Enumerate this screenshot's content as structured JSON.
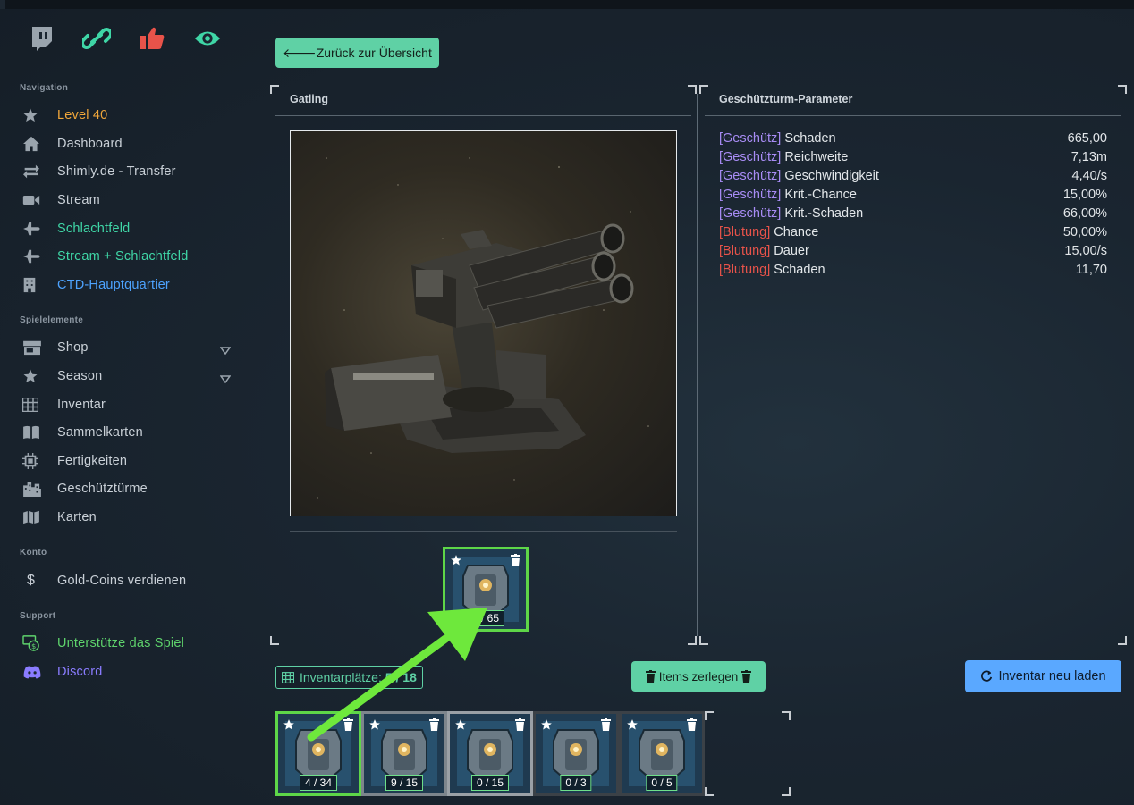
{
  "social": [
    {
      "icon": "twitch-icon",
      "color": "#9aa4ad"
    },
    {
      "icon": "link-icon",
      "color": "#3fd6a6"
    },
    {
      "icon": "thumbs-up-icon",
      "color": "#e8534a"
    },
    {
      "icon": "eye-icon",
      "color": "#3fd6a6"
    }
  ],
  "sidebar": {
    "sections": {
      "navigation": "Navigation",
      "elements": "Spielelemente",
      "account": "Konto",
      "support": "Support"
    },
    "nav": [
      {
        "label": "Level 40",
        "icon": "star-icon"
      },
      {
        "label": "Dashboard",
        "icon": "home-icon"
      },
      {
        "label": "Shimly.de - Transfer",
        "icon": "transfer-icon"
      },
      {
        "label": "Stream",
        "icon": "video-icon"
      },
      {
        "label": "Schlachtfeld",
        "icon": "plane-icon"
      },
      {
        "label": "Stream + Schlachtfeld",
        "icon": "plane-icon"
      },
      {
        "label": "CTD-Hauptquartier",
        "icon": "building-icon"
      }
    ],
    "elements": [
      {
        "label": "Shop",
        "icon": "store-icon"
      },
      {
        "label": "Season",
        "icon": "star-icon"
      },
      {
        "label": "Inventar",
        "icon": "grid-icon"
      },
      {
        "label": "Sammelkarten",
        "icon": "book-icon"
      },
      {
        "label": "Fertigkeiten",
        "icon": "chip-icon"
      },
      {
        "label": "Geschütztürme",
        "icon": "city-icon"
      },
      {
        "label": "Karten",
        "icon": "map-icon"
      }
    ],
    "account": [
      {
        "label": "Gold-Coins verdienen",
        "icon": "dollar-icon"
      }
    ],
    "support": [
      {
        "label": "Unterstütze das Spiel",
        "icon": "money-icon"
      },
      {
        "label": "Discord",
        "icon": "discord-icon"
      }
    ]
  },
  "back_button": "🡐Zurück zur Übersicht",
  "turret_panel": {
    "title": "Gatling",
    "equipped_item": {
      "count": "0 / 65"
    }
  },
  "param_panel": {
    "title": "Geschützturm-Parameter",
    "rows": [
      {
        "tag": "Geschütz",
        "name": "Schaden",
        "value": "665,00"
      },
      {
        "tag": "Geschütz",
        "name": "Reichweite",
        "value": "7,13m"
      },
      {
        "tag": "Geschütz",
        "name": "Geschwindigkeit",
        "value": "4,40/s"
      },
      {
        "tag": "Geschütz",
        "name": "Krit.-Chance",
        "value": "15,00%"
      },
      {
        "tag": "Geschütz",
        "name": "Krit.-Schaden",
        "value": "66,00%"
      },
      {
        "tag": "Blutung",
        "name": "Chance",
        "value": "50,00%"
      },
      {
        "tag": "Blutung",
        "name": "Dauer",
        "value": "15,00/s"
      },
      {
        "tag": "Blutung",
        "name": "Schaden",
        "value": "11,70"
      }
    ]
  },
  "inventory": {
    "label": "Inventarplätze",
    "count": "5 / 18",
    "disassemble_button": "Items zerlegen",
    "reload_button": "Inventar neu laden",
    "items": [
      {
        "count": "4 / 34",
        "selected": true
      },
      {
        "count": "9 / 15",
        "selected": false
      },
      {
        "count": "0 / 15",
        "selected": false
      },
      {
        "count": "0 / 3",
        "selected": false
      },
      {
        "count": "0 / 5",
        "selected": false
      }
    ]
  },
  "colors": {
    "accent": "#5fd1a5",
    "blue": "#5aa8ff",
    "selected_border": "#5ed648",
    "level": "#f0a63a"
  }
}
